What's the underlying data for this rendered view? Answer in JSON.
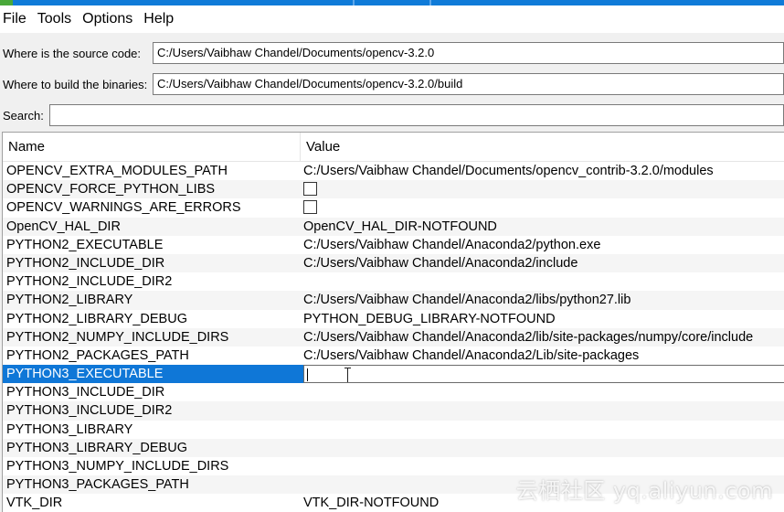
{
  "menu": {
    "file": "File",
    "tools": "Tools",
    "options": "Options",
    "help": "Help"
  },
  "source": {
    "label": "Where is the source code:",
    "value": "C:/Users/Vaibhaw Chandel/Documents/opencv-3.2.0"
  },
  "build": {
    "label": "Where to build the binaries:",
    "value": "C:/Users/Vaibhaw Chandel/Documents/opencv-3.2.0/build"
  },
  "search": {
    "label": "Search:",
    "value": ""
  },
  "table": {
    "headers": {
      "name": "Name",
      "value": "Value"
    },
    "rows": [
      {
        "name": "OPENCV_EXTRA_MODULES_PATH",
        "value": "C:/Users/Vaibhaw Chandel/Documents/opencv_contrib-3.2.0/modules"
      },
      {
        "name": "OPENCV_FORCE_PYTHON_LIBS",
        "value": ""
      },
      {
        "name": "OPENCV_WARNINGS_ARE_ERRORS",
        "value": ""
      },
      {
        "name": "OpenCV_HAL_DIR",
        "value": "OpenCV_HAL_DIR-NOTFOUND"
      },
      {
        "name": "PYTHON2_EXECUTABLE",
        "value": "C:/Users/Vaibhaw Chandel/Anaconda2/python.exe"
      },
      {
        "name": "PYTHON2_INCLUDE_DIR",
        "value": "C:/Users/Vaibhaw Chandel/Anaconda2/include"
      },
      {
        "name": "PYTHON2_INCLUDE_DIR2",
        "value": ""
      },
      {
        "name": "PYTHON2_LIBRARY",
        "value": "C:/Users/Vaibhaw Chandel/Anaconda2/libs/python27.lib"
      },
      {
        "name": "PYTHON2_LIBRARY_DEBUG",
        "value": "PYTHON_DEBUG_LIBRARY-NOTFOUND"
      },
      {
        "name": "PYTHON2_NUMPY_INCLUDE_DIRS",
        "value": "C:/Users/Vaibhaw Chandel/Anaconda2/lib/site-packages/numpy/core/include"
      },
      {
        "name": "PYTHON2_PACKAGES_PATH",
        "value": "C:/Users/Vaibhaw Chandel/Anaconda2/Lib/site-packages"
      },
      {
        "name": "PYTHON3_EXECUTABLE",
        "value": ""
      },
      {
        "name": "PYTHON3_INCLUDE_DIR",
        "value": ""
      },
      {
        "name": "PYTHON3_INCLUDE_DIR2",
        "value": ""
      },
      {
        "name": "PYTHON3_LIBRARY",
        "value": ""
      },
      {
        "name": "PYTHON3_LIBRARY_DEBUG",
        "value": ""
      },
      {
        "name": "PYTHON3_NUMPY_INCLUDE_DIRS",
        "value": ""
      },
      {
        "name": "PYTHON3_PACKAGES_PATH",
        "value": ""
      },
      {
        "name": "VTK_DIR",
        "value": "VTK_DIR-NOTFOUND"
      }
    ]
  },
  "colors": {
    "selection": "#0f77d7",
    "titlebar": "#0f7bd8"
  },
  "icons": {
    "text_cursor": "i-beam-cursor-icon",
    "checkbox": "checkbox-unchecked-icon"
  },
  "watermark": "云栖社区 yq.aliyun.com"
}
